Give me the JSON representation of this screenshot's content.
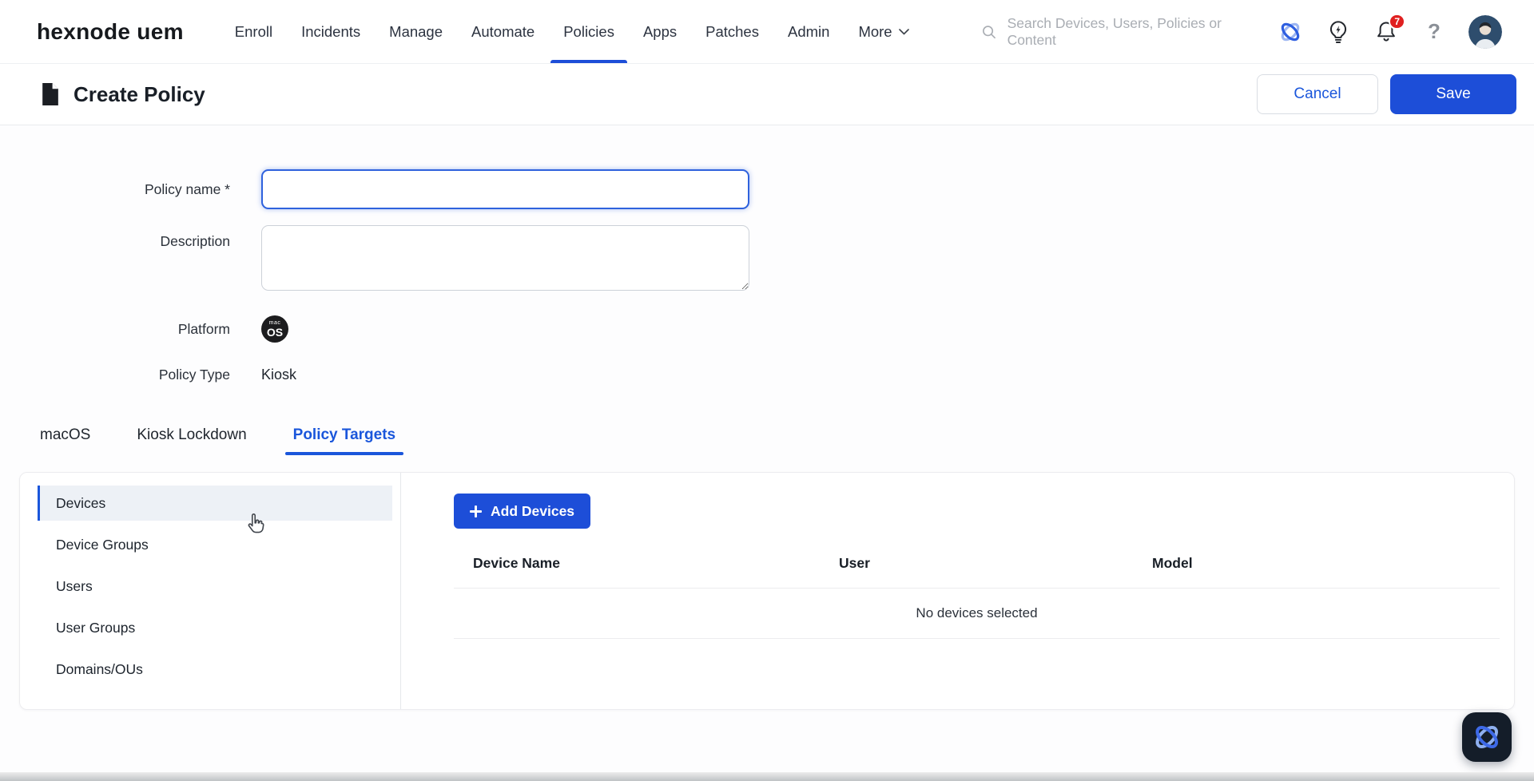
{
  "nav": {
    "logo": "hexnode uem",
    "items": [
      {
        "label": "Enroll"
      },
      {
        "label": "Incidents"
      },
      {
        "label": "Manage"
      },
      {
        "label": "Automate"
      },
      {
        "label": "Policies"
      },
      {
        "label": "Apps"
      },
      {
        "label": "Patches"
      },
      {
        "label": "Admin"
      },
      {
        "label": "More"
      }
    ],
    "active_item": "Policies",
    "search_placeholder": "Search Devices, Users, Policies or Content",
    "notification_count": "7",
    "help_glyph": "?"
  },
  "header": {
    "title": "Create Policy",
    "cancel_label": "Cancel",
    "save_label": "Save"
  },
  "form": {
    "policy_name": {
      "label": "Policy name *",
      "value": ""
    },
    "description": {
      "label": "Description",
      "value": ""
    },
    "platform": {
      "label": "Platform",
      "badge_line1": "mac",
      "badge_line2": "OS"
    },
    "policy_type": {
      "label": "Policy Type",
      "value": "Kiosk"
    }
  },
  "tabs": [
    {
      "label": "macOS"
    },
    {
      "label": "Kiosk Lockdown"
    },
    {
      "label": "Policy Targets"
    }
  ],
  "active_tab": "Policy Targets",
  "targets": {
    "sidebar": [
      {
        "label": "Devices"
      },
      {
        "label": "Device Groups"
      },
      {
        "label": "Users"
      },
      {
        "label": "User Groups"
      },
      {
        "label": "Domains/OUs"
      }
    ],
    "selected_item": "Devices",
    "add_devices_label": "Add Devices",
    "columns": [
      {
        "label": "Device Name"
      },
      {
        "label": "User"
      },
      {
        "label": "Model"
      }
    ],
    "empty_text": "No devices selected"
  },
  "colors": {
    "primary_blue": "#1d4ed8",
    "link_blue": "#1a56db",
    "badge_red": "#e02020",
    "dark_fab": "#141d29"
  }
}
